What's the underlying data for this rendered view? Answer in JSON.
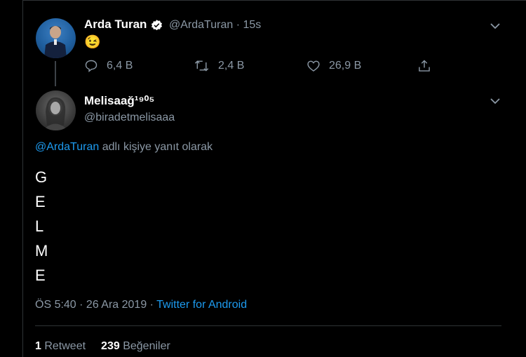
{
  "tweet": {
    "author_name": "Arda Turan",
    "author_handle": "@ArdaTuran",
    "time_sep": " · ",
    "time": "15s",
    "content": "😉",
    "actions": {
      "reply_count": "6,4 B",
      "retweet_count": "2,4 B",
      "like_count": "26,9 B"
    }
  },
  "reply": {
    "author_name": "Melisaağ¹⁹⁰⁵",
    "author_handle": "@biradetmelisaaa",
    "replying_to_handle": "@ArdaTuran",
    "replying_to_suffix": " adlı kişiye yanıt olarak",
    "letters": [
      "G",
      "E",
      "L",
      "M",
      "E"
    ],
    "timestamp": "ÖS 5:40 · 26 Ara 2019 · ",
    "client": "Twitter for Android",
    "stats": {
      "retweet_count": "1",
      "retweet_label": " Retweet",
      "like_count": "239",
      "like_label": " Beğeniler"
    }
  },
  "colors": {
    "background": "#000000",
    "text_primary": "#ffffff",
    "text_secondary": "#8b98a5",
    "accent": "#1d9bf0"
  },
  "icons": [
    "verified-badge-icon",
    "chevron-down-icon",
    "reply-icon",
    "retweet-icon",
    "like-icon",
    "share-icon"
  ]
}
